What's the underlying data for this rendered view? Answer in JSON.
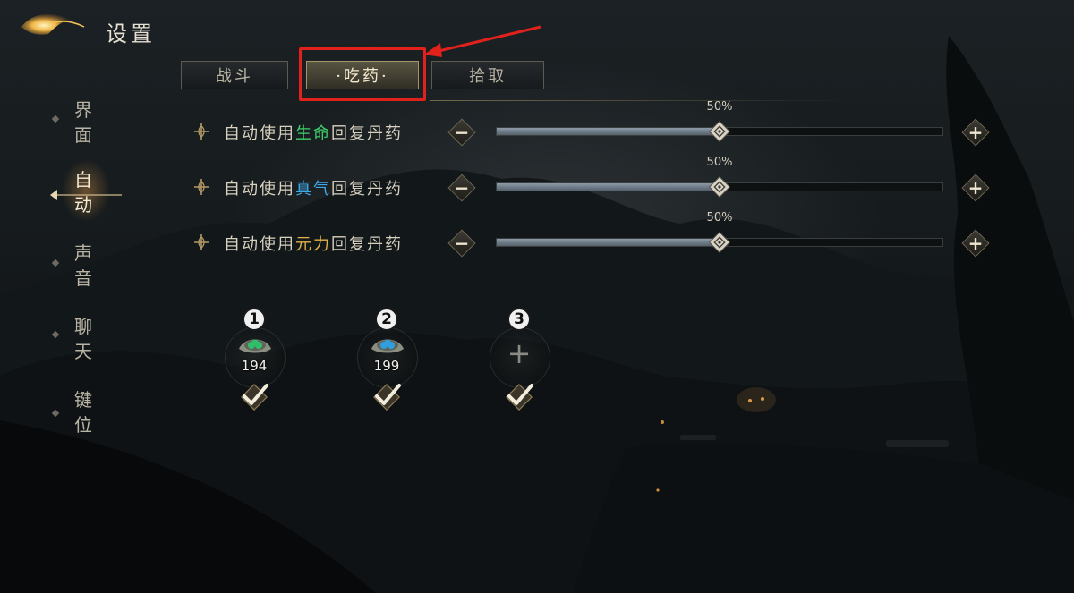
{
  "header": {
    "title": "设置"
  },
  "tabs": [
    {
      "label": "战斗",
      "active": false
    },
    {
      "label": "·吃药·",
      "active": true
    },
    {
      "label": "拾取",
      "active": false
    }
  ],
  "sidebar": {
    "items": [
      {
        "label": "界面",
        "active": false
      },
      {
        "label": "自动",
        "active": true
      },
      {
        "label": "声音",
        "active": false
      },
      {
        "label": "聊天",
        "active": false
      },
      {
        "label": "键位",
        "active": false
      }
    ]
  },
  "potion_settings": [
    {
      "prefix": "自动使用",
      "highlight": "生命",
      "suffix": "回复丹药",
      "highlight_color": "#3fcf6a",
      "value_label": "50%",
      "value": 0.5
    },
    {
      "prefix": "自动使用",
      "highlight": "真气",
      "suffix": "回复丹药",
      "highlight_color": "#3fa9e8",
      "value_label": "50%",
      "value": 0.5
    },
    {
      "prefix": "自动使用",
      "highlight": "元力",
      "suffix": "回复丹药",
      "highlight_color": "#e2b247",
      "value_label": "50%",
      "value": 0.5
    }
  ],
  "slots": [
    {
      "number": "1",
      "count": "194",
      "empty": false,
      "checked": true,
      "gem_color": "#2fbf6a"
    },
    {
      "number": "2",
      "count": "199",
      "empty": false,
      "checked": true,
      "gem_color": "#2f9fe0"
    },
    {
      "number": "3",
      "count": "",
      "empty": true,
      "plus": "+",
      "checked": true
    }
  ],
  "icons": {
    "minus": "−",
    "plus": "+"
  },
  "colors": {
    "highlight_box": "#e0211c",
    "arrow": "#e0211c"
  }
}
